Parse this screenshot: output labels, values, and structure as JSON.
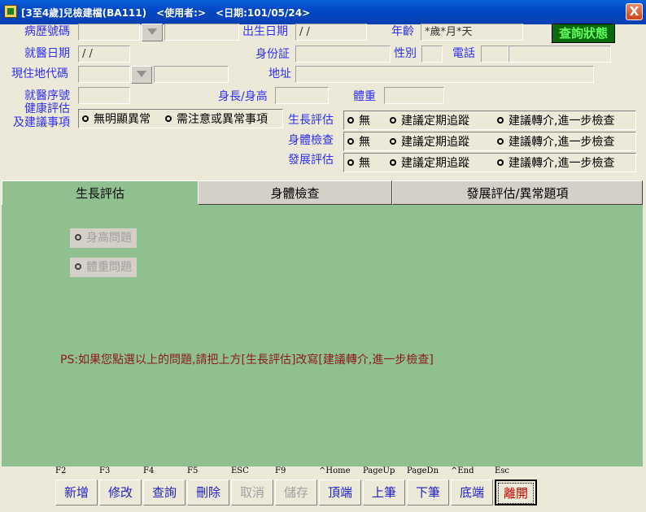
{
  "window": {
    "title": "[3至4歲]兒檢建檔(BA111)　<使用者:>　<日期:101/05/24>",
    "close": "X"
  },
  "form": {
    "chart_no_label": "病歷號碼",
    "birth_label": "出生日期",
    "birth_value": "/ /",
    "age_label": "年齡",
    "age_value": "*歲*月*天",
    "status_badge": "查詢狀態",
    "visit_date_label": "就醫日期",
    "visit_date_value": "/ /",
    "id_label": "身份証",
    "sex_label": "性別",
    "phone_label": "電話",
    "area_label": "現住地代碼",
    "address_label": "地址",
    "visit_seq_label": "就醫序號",
    "height_label": "身長/身高",
    "weight_label": "體重",
    "health_label_1": "健康評估",
    "health_label_2": "及建議事項",
    "health_opts": [
      "無明顯異常",
      "需注意或異常事項"
    ],
    "growth_label": "生長評估",
    "exam_label": "身體檢查",
    "dev_label": "發展評估",
    "eval_opts": [
      "無",
      "建議定期追蹤",
      "建議轉介,進一步檢查"
    ]
  },
  "tabs": [
    "生長評估",
    "身體檢查",
    "發展評估/異常題項"
  ],
  "growth_tab": {
    "items": [
      "身高問題",
      "體重問題"
    ],
    "note": "PS:如果您點選以上的問題,請把上方[生長評估]改寫[建議轉介,進一步檢查]"
  },
  "toolbar": {
    "keys": [
      "F2",
      "F3",
      "F4",
      "F5",
      "ESC",
      "F9",
      "^Home",
      "PageUp",
      "PageDn",
      "^End",
      "Esc"
    ],
    "buttons": [
      "新增",
      "修改",
      "查詢",
      "刪除",
      "取消",
      "儲存",
      "頂端",
      "上筆",
      "下筆",
      "底端",
      "離開"
    ]
  },
  "colors": {
    "label_blue": "#2f2ff0",
    "tab_green": "#90c090",
    "note_red": "#8b1a1a",
    "exit_red": "#c00000"
  }
}
